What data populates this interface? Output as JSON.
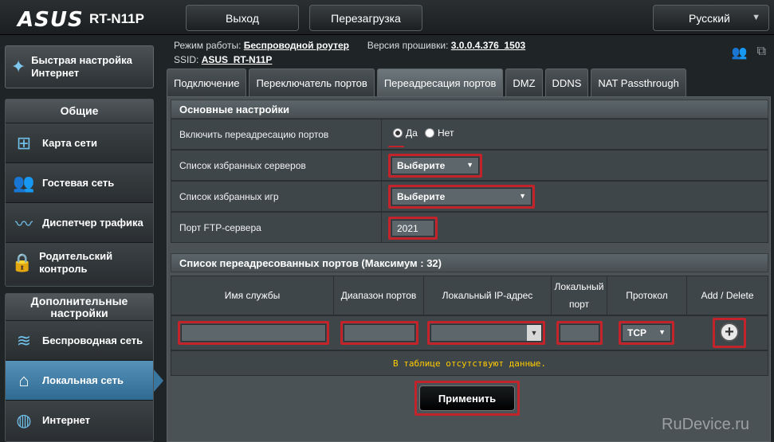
{
  "header": {
    "logo": "ASUS",
    "model": "RT-N11P",
    "logout_label": "Выход",
    "reboot_label": "Перезагрузка",
    "language": "Русский"
  },
  "info": {
    "mode_label": "Режим работы:",
    "mode_value": "Беспроводной роутер",
    "firmware_label": "Версия прошивки:",
    "firmware_value": "3.0.0.4.376_1503",
    "ssid_label": "SSID:",
    "ssid_value": "ASUS_RT-N11P"
  },
  "sidebar": {
    "quick_setup": "Быстрая настройка Интернет",
    "general_title": "Общие",
    "general_items": [
      {
        "label": "Карта сети",
        "icon": "network-map-icon"
      },
      {
        "label": "Гостевая сеть",
        "icon": "guest-network-icon"
      },
      {
        "label": "Диспетчер трафика",
        "icon": "traffic-manager-icon"
      },
      {
        "label": "Родительский контроль",
        "icon": "parental-control-icon"
      }
    ],
    "advanced_title": "Дополнительные настройки",
    "advanced_items": [
      {
        "label": "Беспроводная сеть",
        "icon": "wireless-icon"
      },
      {
        "label": "Локальная сеть",
        "icon": "lan-icon",
        "active": true
      },
      {
        "label": "Интернет",
        "icon": "globe-icon"
      }
    ]
  },
  "tabs": [
    {
      "label": "Подключение"
    },
    {
      "label": "Переключатель портов"
    },
    {
      "label": "Переадресация портов",
      "active": true
    },
    {
      "label": "DMZ"
    },
    {
      "label": "DDNS"
    },
    {
      "label": "NAT Passthrough"
    }
  ],
  "basic": {
    "title": "Основные настройки",
    "enable_label": "Включить переадресацию портов",
    "yes": "Да",
    "no": "Нет",
    "servers_label": "Список избранных серверов",
    "servers_value": "Выберите",
    "games_label": "Список избранных игр",
    "games_value": "Выберите",
    "ftp_label": "Порт FTP-сервера",
    "ftp_value": "2021"
  },
  "list": {
    "title": "Список переадресованных портов (Максимум : 32)",
    "columns": [
      "Имя службы",
      "Диапазон портов",
      "Локальный IP-адрес",
      "Локальный порт",
      "Протокол",
      "Add / Delete"
    ],
    "protocol_value": "TCP",
    "empty_text": "В таблице отсутствуют данные."
  },
  "apply_label": "Применить",
  "watermark": "RuDevice.ru",
  "colors": {
    "highlight": "#c3232a",
    "active_nav": "#3a77a0",
    "empty_text": "#ffcc00"
  }
}
